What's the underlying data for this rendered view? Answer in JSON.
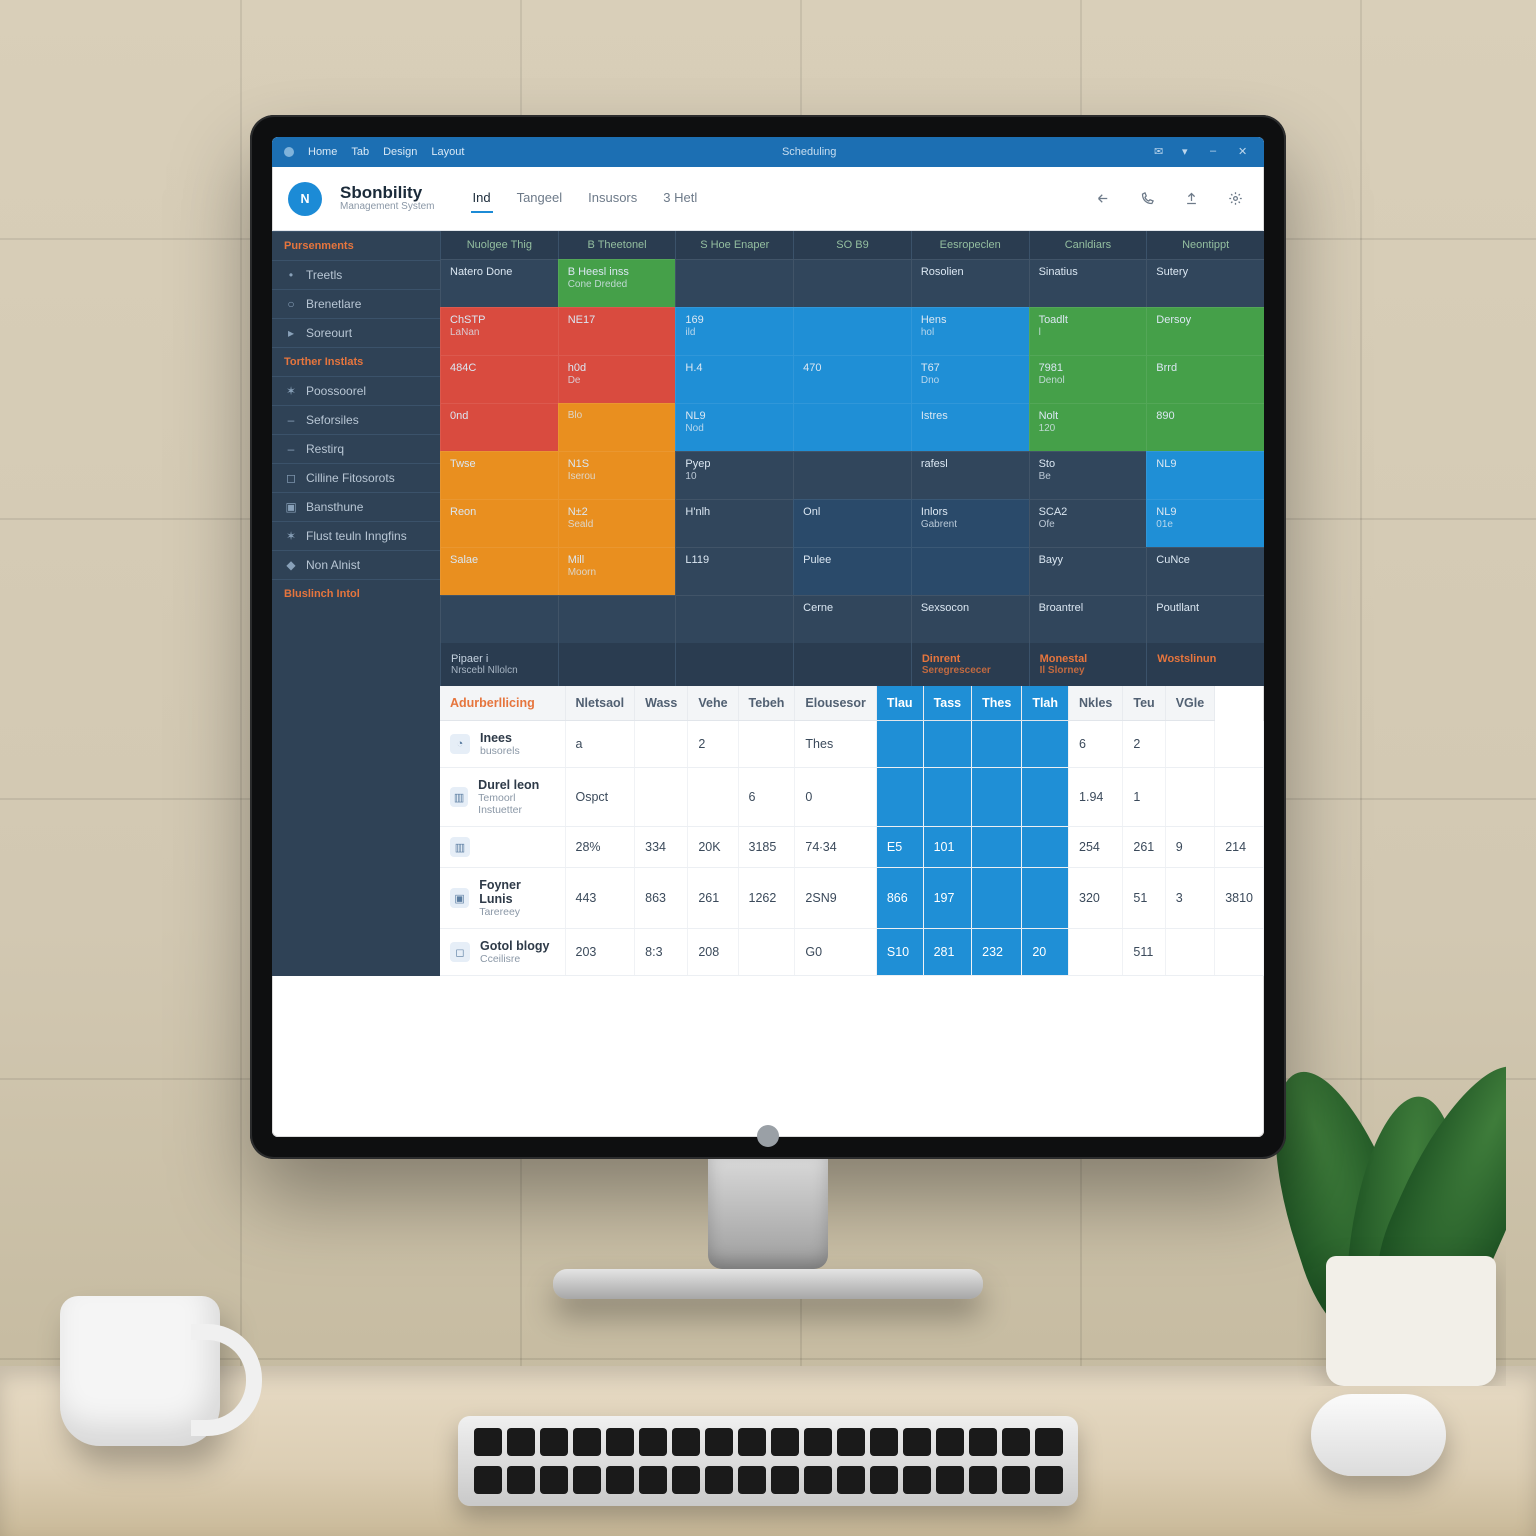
{
  "titlebar": {
    "menu": [
      "Home",
      "Tab",
      "Design",
      "Layout"
    ],
    "center": "Scheduling",
    "right_icons": [
      "mail-icon",
      "chevron-down-icon",
      "minimize-icon",
      "close-icon"
    ]
  },
  "appbar": {
    "logo_letter": "N",
    "brand_title": "Sbonbility",
    "brand_sub": "Management System",
    "tabs": [
      "Ind",
      "Tangeel",
      "Insusors",
      "3 Hetl"
    ],
    "active_tab": 0,
    "toolbar_icons": [
      "share-icon",
      "phone-icon",
      "upload-icon",
      "gear-icon"
    ]
  },
  "sidebar": {
    "sections": [
      {
        "title": "Pursenments",
        "items": [
          {
            "glyph": "•",
            "label": "Treetls"
          },
          {
            "glyph": "○",
            "label": "Brenetlare"
          },
          {
            "glyph": "▸",
            "label": "Soreourt"
          }
        ]
      },
      {
        "title": "Torther Instlats",
        "items": [
          {
            "glyph": "✶",
            "label": "Poossoorel"
          },
          {
            "glyph": "–",
            "label": "Seforsiles"
          },
          {
            "glyph": "–",
            "label": "Restirq"
          }
        ]
      },
      {
        "title": "",
        "items": [
          {
            "glyph": "◻",
            "label": "Cilline Fitosorots"
          },
          {
            "glyph": "▣",
            "label": "Bansthune"
          },
          {
            "glyph": "✶",
            "label": "Flust teuln Inngfins"
          },
          {
            "glyph": "◆",
            "label": "Non Alnist"
          }
        ]
      },
      {
        "title": "Bluslinch Intol",
        "items": []
      }
    ]
  },
  "heatmap": {
    "headers": [
      "Nuolgee Thig",
      "B Theetonel",
      "S Hoe Enaper",
      "SO B9",
      "Eesropeclen",
      "Canldiars",
      "Neontippt"
    ],
    "rows": [
      [
        {
          "c": "navy",
          "t": "Natero Done"
        },
        {
          "c": "green",
          "t": "B Heesl inss",
          "s": "Cone Dreded"
        },
        {
          "c": "navy",
          "t": ""
        },
        {
          "c": "navy",
          "t": ""
        },
        {
          "c": "navy",
          "t": "Rosolien"
        },
        {
          "c": "navy",
          "t": "Sinatius"
        },
        {
          "c": "navy",
          "t": "Sutery"
        }
      ],
      [
        {
          "c": "red",
          "t": "ChSTP",
          "s": "LaNan"
        },
        {
          "c": "red",
          "t": "NE17"
        },
        {
          "c": "blue",
          "t": "169",
          "s": "ild"
        },
        {
          "c": "blue",
          "t": ""
        },
        {
          "c": "blue",
          "t": "Hens",
          "s": "hol"
        },
        {
          "c": "green",
          "t": "Toadlt",
          "s": "l"
        },
        {
          "c": "green",
          "t": "Dersoy"
        }
      ],
      [
        {
          "c": "red",
          "t": "484C"
        },
        {
          "c": "red",
          "t": "h0d",
          "s": "De"
        },
        {
          "c": "blue",
          "t": "H.4"
        },
        {
          "c": "blue",
          "t": "470"
        },
        {
          "c": "blue",
          "t": "T67",
          "s": "Dno"
        },
        {
          "c": "green",
          "t": "7981",
          "s": "Denol"
        },
        {
          "c": "green",
          "t": "Brrd"
        }
      ],
      [
        {
          "c": "red",
          "t": "0nd"
        },
        {
          "c": "orange",
          "t": "",
          "s": "Blo"
        },
        {
          "c": "blue",
          "t": "NL9",
          "s": "Nod"
        },
        {
          "c": "blue",
          "t": ""
        },
        {
          "c": "blue",
          "t": "Istres"
        },
        {
          "c": "green",
          "t": "Nolt",
          "s": "120"
        },
        {
          "c": "green",
          "t": "890"
        }
      ],
      [
        {
          "c": "orange",
          "t": "Twse"
        },
        {
          "c": "orange",
          "t": "N1S",
          "s": "Iserou"
        },
        {
          "c": "navy",
          "t": "Pyep",
          "s": "10"
        },
        {
          "c": "navy",
          "t": ""
        },
        {
          "c": "navy",
          "t": "rafesl"
        },
        {
          "c": "navy",
          "t": "Sto",
          "s": "Be"
        },
        {
          "c": "blue",
          "t": "NL9"
        }
      ],
      [
        {
          "c": "orange",
          "t": "Reon"
        },
        {
          "c": "orange",
          "t": "N±2",
          "s": "Seald"
        },
        {
          "c": "navy",
          "t": "H'nlh"
        },
        {
          "c": "dblue",
          "t": "Onl"
        },
        {
          "c": "dblue",
          "t": "Inlors",
          "s": "Gabrent"
        },
        {
          "c": "navy",
          "t": "SCA2",
          "s": "Ofe"
        },
        {
          "c": "blue",
          "t": "NL9",
          "s": "01e"
        }
      ],
      [
        {
          "c": "orange",
          "t": "Salae"
        },
        {
          "c": "orange",
          "t": "Mill",
          "s": "Moorn"
        },
        {
          "c": "navy",
          "t": "L119"
        },
        {
          "c": "dblue",
          "t": "Pulee"
        },
        {
          "c": "dblue",
          "t": ""
        },
        {
          "c": "navy",
          "t": "Bayy"
        },
        {
          "c": "navy",
          "t": "CuNce"
        }
      ],
      [
        {
          "c": "navy",
          "t": ""
        },
        {
          "c": "navy",
          "t": ""
        },
        {
          "c": "navy",
          "t": ""
        },
        {
          "c": "navy",
          "t": "Cerne"
        },
        {
          "c": "navy",
          "t": "Sexsocon"
        },
        {
          "c": "navy",
          "t": "Broantrel"
        },
        {
          "c": "navy",
          "t": "Poutllant"
        }
      ]
    ],
    "footer": [
      {
        "t": "Pipaer i",
        "s": "Nrscebl Nllolcn",
        "hl": false
      },
      {
        "t": "",
        "s": "",
        "hl": false
      },
      {
        "t": "",
        "s": "",
        "hl": false
      },
      {
        "t": "",
        "s": "",
        "hl": false
      },
      {
        "t": "Dinrent",
        "s": "Seregrescecer",
        "hl": true
      },
      {
        "t": "Monestal",
        "s": "Il Slorney",
        "hl": true
      },
      {
        "t": "Wostslinun",
        "s": "",
        "hl": true
      }
    ]
  },
  "table": {
    "title": "Adurberllicing",
    "columns": [
      "",
      "Nletsaol",
      "Wass",
      "Vehe",
      "Tebeh",
      "Elousesor",
      "Tlau",
      "Tass",
      "Thes",
      "Tlah",
      "Nkles",
      "Teu",
      "VGle"
    ],
    "rows": [
      {
        "icon": "◔",
        "title": "Inees",
        "sub": "busorels",
        "cells": [
          "a",
          "",
          "2",
          "",
          "Thes",
          "",
          "",
          "",
          "",
          "6",
          "2",
          "",
          ""
        ]
      },
      {
        "icon": "▥",
        "title": "Durel leon",
        "sub": "Temoorl Instuetter",
        "cells": [
          "Ospct",
          "",
          "",
          "6",
          "0",
          "",
          "",
          "",
          "",
          "1.94",
          "1",
          "",
          ""
        ]
      },
      {
        "icon": "▥",
        "title": "",
        "sub": "",
        "cells": [
          "28%",
          "334",
          "20K",
          "3185",
          "74∙34",
          "E5",
          "101",
          "",
          "",
          "254",
          "261",
          "9",
          "214"
        ]
      },
      {
        "icon": "▣",
        "title": "Foyner Lunis",
        "sub": "Tarereey",
        "cells": [
          "443",
          "863",
          "261",
          "1262",
          "2SN9",
          "866",
          "197",
          "",
          "",
          "320",
          "51",
          "3",
          "3810"
        ]
      },
      {
        "icon": "◻",
        "title": "Gotol blogy",
        "sub": "Cceilisre",
        "cells": [
          "203",
          "8:3",
          "208",
          "",
          "G0",
          "S10",
          "281",
          "232",
          "20",
          "",
          "511",
          "",
          ""
        ]
      }
    ],
    "highlight_cols": [
      6,
      7,
      8,
      9
    ]
  },
  "colors": {
    "navy": "#31465c",
    "blue": "#1f8fd6",
    "green": "#45a049",
    "red": "#d94b3f",
    "orange": "#e98f1f",
    "accent": "#1c8bd6"
  }
}
